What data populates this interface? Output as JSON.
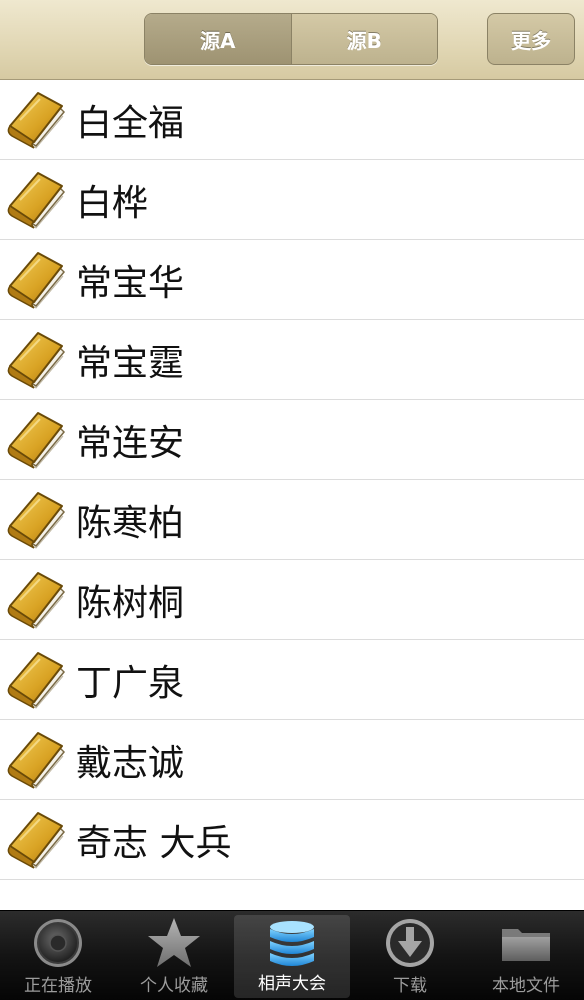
{
  "navbar": {
    "segments": [
      {
        "label": "源A",
        "selected": true
      },
      {
        "label": "源B",
        "selected": false
      }
    ],
    "more_label": "更多"
  },
  "list": {
    "icon": "book-icon",
    "items": [
      {
        "label": "白全福"
      },
      {
        "label": "白桦"
      },
      {
        "label": "常宝华"
      },
      {
        "label": "常宝霆"
      },
      {
        "label": "常连安"
      },
      {
        "label": "陈寒柏"
      },
      {
        "label": "陈树桐"
      },
      {
        "label": "丁广泉"
      },
      {
        "label": "戴志诚"
      },
      {
        "label": "奇志 大兵"
      }
    ]
  },
  "tabbar": {
    "active_index": 2,
    "tabs": [
      {
        "label": "正在播放",
        "icon": "speaker-icon"
      },
      {
        "label": "个人收藏",
        "icon": "star-icon"
      },
      {
        "label": "相声大会",
        "icon": "database-icon"
      },
      {
        "label": "下载",
        "icon": "download-icon"
      },
      {
        "label": "本地文件",
        "icon": "folder-icon"
      }
    ]
  },
  "colors": {
    "navbar_bg": "#e2d8b6",
    "tabbar_bg": "#141414",
    "active_tab_icon": "#3fa6e6"
  }
}
